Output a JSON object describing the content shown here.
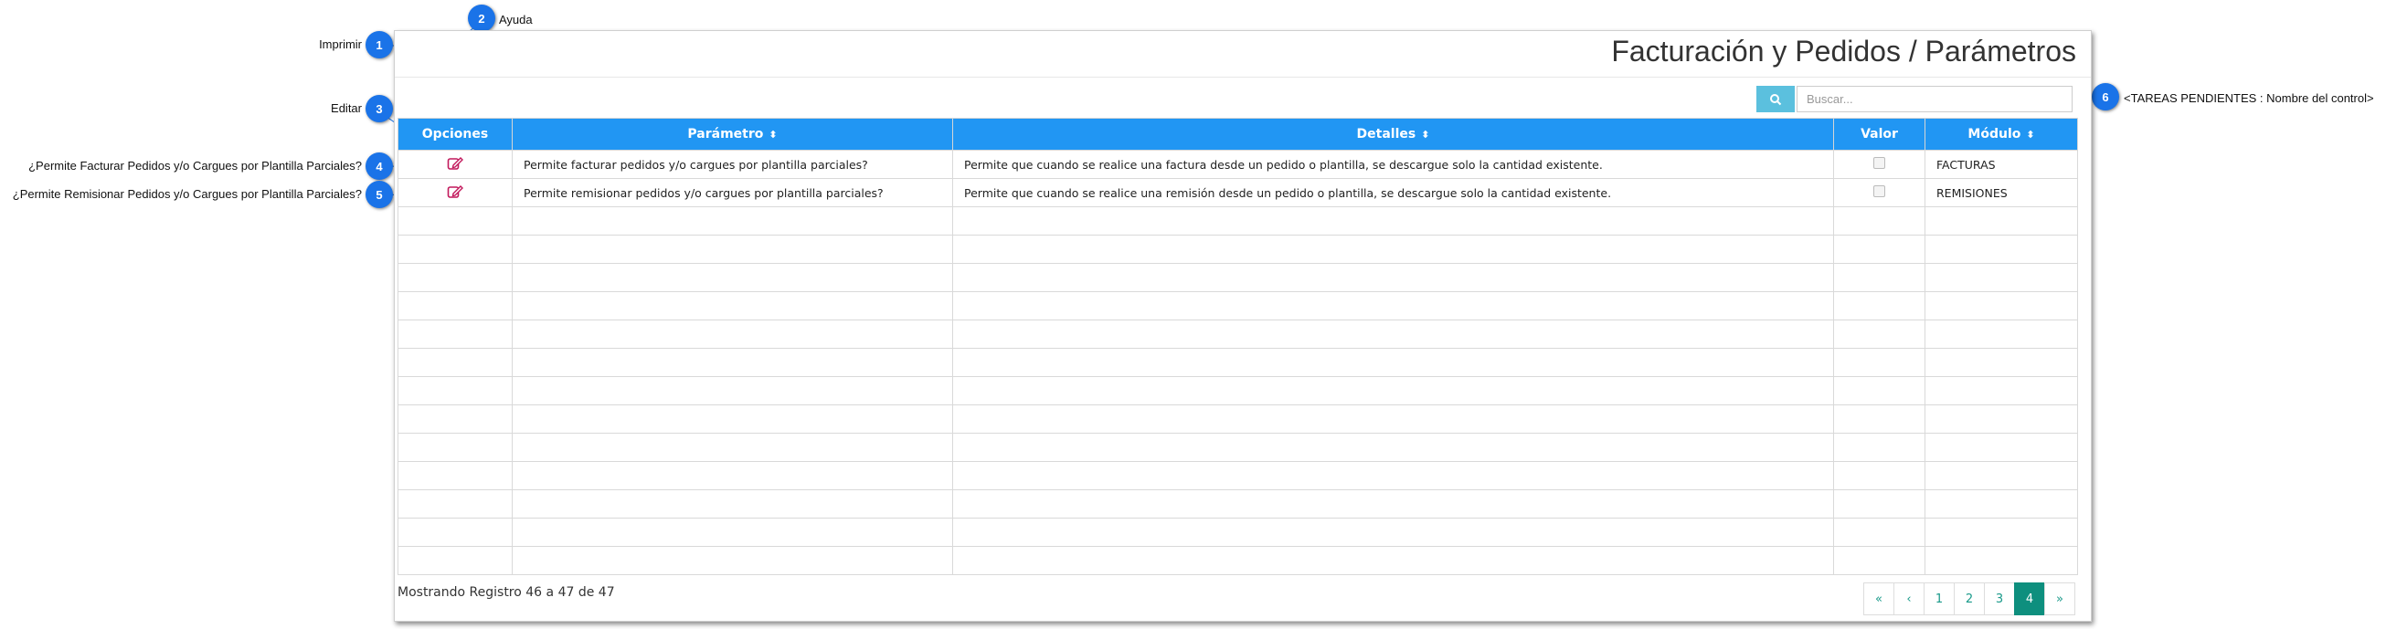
{
  "toolbar": {
    "print_label": "Imprimir",
    "help_label": "Ayuda"
  },
  "page": {
    "title": "Facturación y Pedidos / Parámetros"
  },
  "search": {
    "placeholder": "Buscar..."
  },
  "table": {
    "columns": [
      "Opciones",
      "Parámetro",
      "Detalles",
      "Valor",
      "Módulo"
    ],
    "rows": [
      {
        "parametro": "Permite facturar pedidos y/o cargues por plantilla parciales?",
        "detalles": "Permite que cuando se realice una factura desde un pedido o plantilla, se descargue solo la cantidad existente.",
        "valor": false,
        "modulo": "FACTURAS"
      },
      {
        "parametro": "Permite remisionar pedidos y/o cargues por plantilla parciales?",
        "detalles": "Permite que cuando se realice una remisión desde un pedido o plantilla, se descargue solo la cantidad existente.",
        "valor": false,
        "modulo": "REMISIONES"
      }
    ],
    "empty_rows": 13
  },
  "footer": {
    "showing": "Mostrando Registro 46 a 47 de 47"
  },
  "pagination": {
    "first": "«",
    "prev": "‹",
    "pages": [
      "1",
      "2",
      "3",
      "4"
    ],
    "active": "4",
    "next": "»"
  },
  "callouts": [
    {
      "num": "1",
      "text": "Imprimir"
    },
    {
      "num": "2",
      "text": "Ayuda"
    },
    {
      "num": "3",
      "text": "Editar"
    },
    {
      "num": "4",
      "text": "¿Permite Facturar Pedidos y/o Cargues por Plantilla Parciales?"
    },
    {
      "num": "5",
      "text": "¿Permite Remisionar Pedidos y/o Cargues por Plantilla Parciales?"
    },
    {
      "num": "6",
      "text": "<TAREAS PENDIENTES : Nombre del control>"
    }
  ],
  "colors": {
    "header_blue": "#2196f3",
    "teal": "#0e8f7e",
    "search_btn": "#5bc0de",
    "callout_blue": "#1a73e8",
    "edit_icon": "#c2185b"
  }
}
